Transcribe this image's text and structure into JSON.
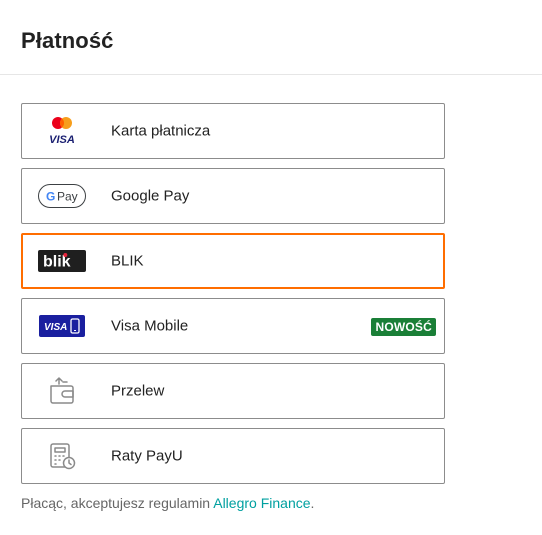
{
  "header": {
    "title": "Płatność"
  },
  "methods": [
    {
      "label": "Karta płatnicza",
      "icon": "card-visa-mastercard-icon",
      "icon_text": "VISA"
    },
    {
      "label": "Google Pay",
      "icon": "google-pay-icon",
      "icon_text": "Pay"
    },
    {
      "label": "BLIK",
      "icon": "blik-icon",
      "icon_text": "blik",
      "selected": true
    },
    {
      "label": "Visa Mobile",
      "icon": "visa-mobile-icon",
      "icon_text": "VISA",
      "badge": "NOWOŚĆ"
    },
    {
      "label": "Przelew",
      "icon": "wallet-transfer-icon"
    },
    {
      "label": "Raty PayU",
      "icon": "calculator-clock-icon"
    }
  ],
  "footer": {
    "text": "Płacąc, akceptujesz regulamin",
    "link": "Allegro Finance",
    "suffix": "."
  },
  "colors": {
    "selected_border": "#ff6d00",
    "badge_bg": "#1a7f37",
    "link": "#00a0a0",
    "visa_blue": "#1a1f71"
  }
}
